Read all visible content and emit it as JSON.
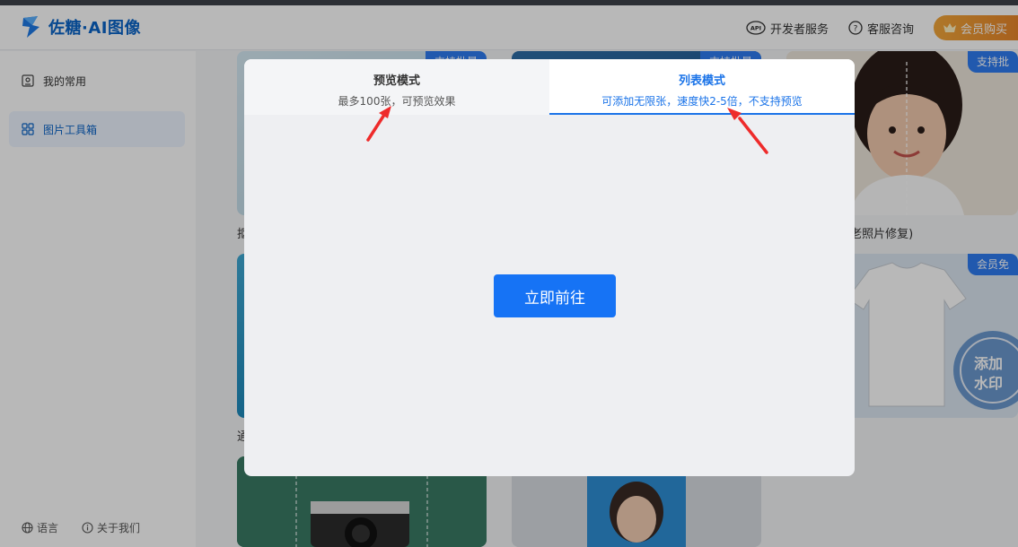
{
  "header": {
    "logo_text": "佐糖·AI图像",
    "links": [
      {
        "label": "开发者服务",
        "icon": "api-icon"
      },
      {
        "label": "客服咨询",
        "icon": "help-icon"
      }
    ],
    "vip_label": "会员购买"
  },
  "sidebar": {
    "items": [
      {
        "label": "我的常用",
        "icon": "recent-icon",
        "active": false
      },
      {
        "label": "图片工具箱",
        "icon": "grid-icon",
        "active": true
      }
    ],
    "footer": [
      {
        "label": "语言",
        "icon": "globe-icon"
      },
      {
        "label": "关于我们",
        "icon": "info-icon"
      }
    ]
  },
  "cards": {
    "tags": [
      "支持批量",
      "支持批量",
      "支持批",
      "会员免"
    ],
    "labels": [
      "抠",
      "(老照片修复)",
      "通"
    ]
  },
  "modal": {
    "tabs": [
      {
        "title": "预览模式",
        "subtitle": "最多100张，可预览效果",
        "active": false
      },
      {
        "title": "列表模式",
        "subtitle": "可添加无限张，速度快2-5倍，不支持预览",
        "active": true
      }
    ],
    "go_button": "立即前往"
  },
  "colors": {
    "brand": "#0a64c8",
    "accent": "#1673f5",
    "vip": "#e8862a",
    "annotation_arrow": "#ee2b2b"
  }
}
